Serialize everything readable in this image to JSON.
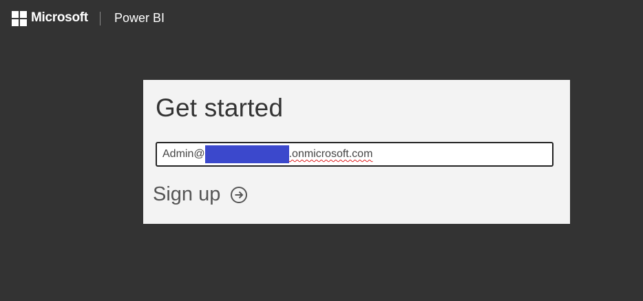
{
  "header": {
    "brand": "Microsoft",
    "product": "Power BI"
  },
  "card": {
    "title": "Get started",
    "email": {
      "prefix": "Admin@",
      "suffix": ".onmicrosoft.com"
    },
    "signup_label": "Sign up",
    "signup_icon": "arrow-right-circle-icon"
  },
  "colors": {
    "background": "#333333",
    "card": "#f3f3f3",
    "redaction": "#3b48cc"
  }
}
